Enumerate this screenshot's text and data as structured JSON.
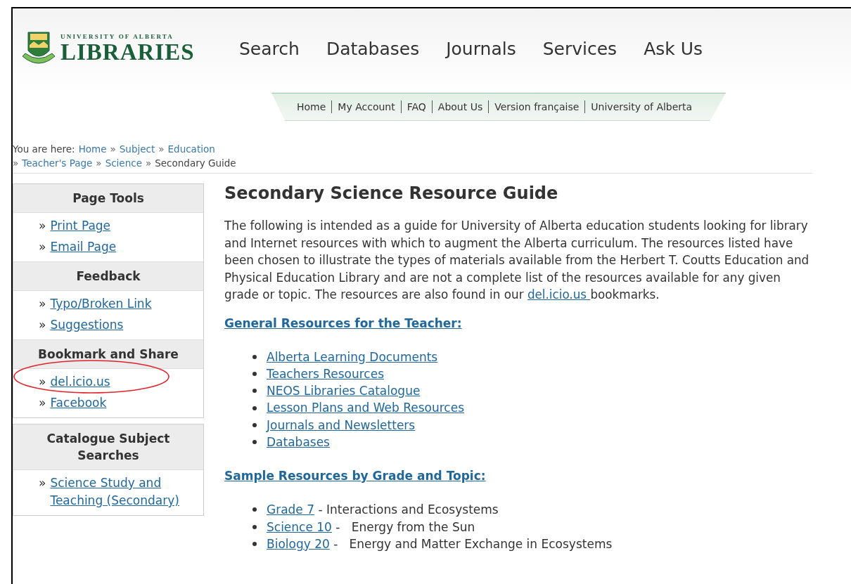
{
  "header": {
    "logo": {
      "top": "UNIVERSITY OF ALBERTA",
      "main": "LIBRARIES"
    },
    "nav": [
      "Search",
      "Databases",
      "Journals",
      "Services",
      "Ask Us"
    ],
    "utility_links": [
      "Home",
      "My Account",
      "FAQ",
      "About Us",
      "Version française",
      "University of Alberta"
    ]
  },
  "breadcrumb": {
    "prefix": "You are here:",
    "separator": "»",
    "lines": [
      [
        {
          "label": "Home",
          "link": true
        },
        {
          "label": "Subject",
          "link": true
        },
        {
          "label": "Education",
          "link": true
        }
      ],
      [
        {
          "label": "Teacher's Page",
          "link": true
        },
        {
          "label": "Science",
          "link": true
        },
        {
          "label": "Secondary Guide",
          "link": false
        }
      ]
    ]
  },
  "sidebar": {
    "boxes": [
      {
        "sections": [
          {
            "title": "Page Tools",
            "links": [
              {
                "marker": "»",
                "label": "Print Page"
              },
              {
                "marker": "»",
                "label": "Email Page"
              }
            ]
          },
          {
            "title": "Feedback",
            "links": [
              {
                "marker": "»",
                "label": "Typo/Broken Link"
              },
              {
                "marker": "»",
                "label": "Suggestions"
              }
            ]
          },
          {
            "title": "Bookmark and Share",
            "links": [
              {
                "marker": "»",
                "label": "del.icio.us",
                "circled": true
              },
              {
                "marker": "»",
                "label": "Facebook",
                "circled": false
              }
            ]
          }
        ]
      },
      {
        "sections": [
          {
            "title": "Catalogue Subject Searches",
            "links": [
              {
                "marker": "»",
                "label": "Science Study and Teaching (Secondary)"
              }
            ]
          }
        ]
      }
    ]
  },
  "main": {
    "title": "Secondary Science Resource Guide",
    "intro": [
      {
        "text": "The following is intended as a guide for University of Alberta education students looking for library and Internet resources with which to augment the Alberta curriculum. The resources listed have been chosen to illustrate the types of materials available from the Herbert T. Coutts Education and Physical Education Library and are not a complete list of the resources available for any given grade or topic.  The resources are also found in our ",
        "link": false
      },
      {
        "text": "del.icio.us ",
        "link": true
      },
      {
        "text": "bookmarks.",
        "link": false
      }
    ],
    "sections": [
      {
        "heading": "General Resources for the Teacher:",
        "items": [
          {
            "link": "Alberta Learning Documents"
          },
          {
            "link": "Teachers Resources"
          },
          {
            "link": "NEOS Libraries Catalogue"
          },
          {
            "link": "Lesson Plans and Web Resources"
          },
          {
            "link": "Journals and Newsletters"
          },
          {
            "link": "Databases"
          }
        ]
      },
      {
        "heading": "Sample Resources by Grade and Topic:",
        "items": [
          {
            "link": "Grade 7",
            "text": " - Interactions and Ecosystems"
          },
          {
            "link": "Science 10",
            "text": " -   Energy from the Sun"
          },
          {
            "link": "Biology 20",
            "text": " -   Energy and Matter Exchange in Ecosystems"
          }
        ]
      }
    ]
  }
}
